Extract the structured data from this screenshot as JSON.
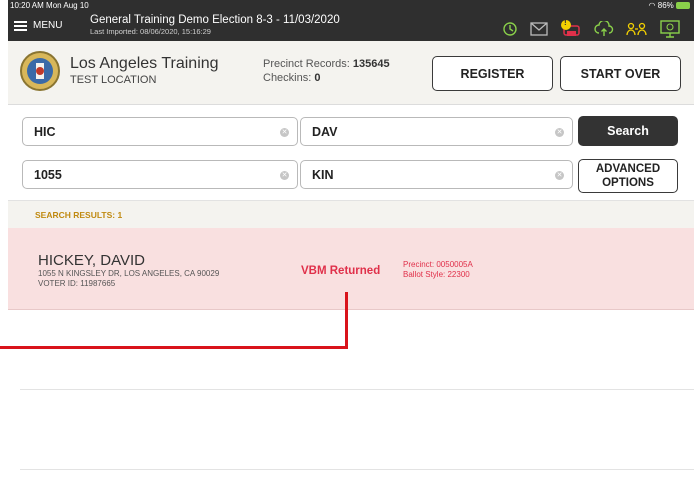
{
  "status_bar": {
    "time": "10:20 AM  Mon Aug 10",
    "battery": "86%"
  },
  "topbar": {
    "menu_label": "MENU",
    "title": "General Training  Demo Election 8-3 - 11/03/2020",
    "subtitle": "Last Imported: 08/06/2020, 15:16:29",
    "icons": [
      "history-icon",
      "mail-icon",
      "alert-printer-icon",
      "cloud-upload-icon",
      "users-icon",
      "monitor-icon"
    ],
    "alert_badge": "!"
  },
  "header": {
    "county_name": "Los Angeles Training",
    "location": "TEST LOCATION",
    "precinct_records_label": "Precinct Records:",
    "precinct_records_value": "135645",
    "checkins_label": "Checkins:",
    "checkins_value": "0",
    "register_label": "REGISTER",
    "start_over_label": "START OVER"
  },
  "search": {
    "last_name": "HIC",
    "first_name": "DAV",
    "house_number": "1055",
    "street": "KIN",
    "search_label": "Search",
    "advanced_line1": "ADVANCED",
    "advanced_line2": "OPTIONS",
    "clear_glyph": "✕"
  },
  "results": {
    "header": "SEARCH RESULTS: 1",
    "items": [
      {
        "name": "HICKEY, DAVID",
        "address": "1055 N KINGSLEY DR, LOS ANGELES, CA 90029",
        "voter_id": "VOTER ID: 11987665",
        "status": "VBM Returned",
        "precinct": "Precinct: 0050005A",
        "ballot_style": "Ballot Style: 22300"
      }
    ]
  },
  "colors": {
    "topbar": "#2f2f2f",
    "header_bg": "#f4f3ef",
    "result_highlight": "#f9e0e0",
    "status_red": "#e0304a",
    "results_label": "#c08a11",
    "annotation_red": "#d9131b",
    "icon_green": "#8ad04a",
    "icon_yellow": "#f4d100"
  }
}
